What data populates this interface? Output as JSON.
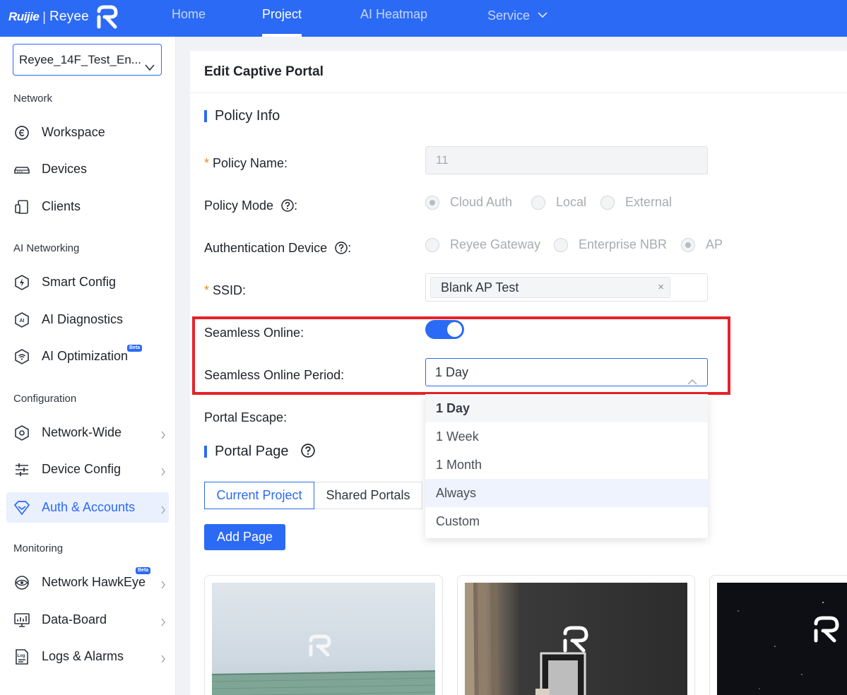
{
  "topbar": {
    "brand": {
      "ruijie": "Ruijie",
      "separator": "|",
      "reyee": "Reyee"
    },
    "nav": [
      {
        "label": "Home",
        "active": false
      },
      {
        "label": "Project",
        "active": true
      },
      {
        "label": "AI Heatmap",
        "active": false
      },
      {
        "label": "Service",
        "active": false,
        "has_dropdown": true
      }
    ],
    "color": "#2b6af5"
  },
  "sidebar": {
    "project_selector": "Reyee_14F_Test_En...",
    "sections": [
      {
        "label": "Network"
      },
      {
        "label": "AI Networking"
      },
      {
        "label": "Configuration"
      },
      {
        "label": "Monitoring"
      }
    ],
    "items": [
      {
        "label": "Workspace",
        "icon": "workspace-icon"
      },
      {
        "label": "Devices",
        "icon": "devices-icon"
      },
      {
        "label": "Clients",
        "icon": "clients-icon"
      },
      {
        "label": "Smart Config",
        "icon": "smart-config-icon"
      },
      {
        "label": "AI Diagnostics",
        "icon": "ai-diagnostics-icon"
      },
      {
        "label": "AI Optimization",
        "icon": "ai-optimization-icon",
        "badge": "Beta"
      },
      {
        "label": "Network-Wide",
        "icon": "network-wide-icon",
        "has_arrow": true
      },
      {
        "label": "Device Config",
        "icon": "device-config-icon",
        "has_arrow": true
      },
      {
        "label": "Auth & Accounts",
        "icon": "auth-accounts-icon",
        "has_arrow": true,
        "active": true
      },
      {
        "label": "Network HawkEye",
        "icon": "hawkeye-icon",
        "has_arrow": true,
        "badge": "Beta"
      },
      {
        "label": "Data-Board",
        "icon": "data-board-icon",
        "has_arrow": true
      },
      {
        "label": "Logs & Alarms",
        "icon": "logs-alarms-icon",
        "has_arrow": true
      }
    ]
  },
  "page": {
    "title": "Edit Captive Portal",
    "policy_info": {
      "section_title": "Policy Info",
      "policy_name": {
        "label": "Policy Name",
        "value": "11",
        "required": true,
        "disabled": true
      },
      "policy_mode": {
        "label": "Policy Mode",
        "options": [
          "Cloud Auth",
          "Local",
          "External"
        ],
        "selected": "Cloud Auth"
      },
      "auth_device": {
        "label": "Authentication Device",
        "options": [
          "Reyee Gateway",
          "Enterprise NBR",
          "AP"
        ],
        "selected": "AP"
      },
      "ssid": {
        "label": "SSID",
        "required": true,
        "tags": [
          "Blank AP Test"
        ],
        "remove_glyph": "×"
      },
      "seamless_online": {
        "label": "Seamless Online",
        "enabled": true
      },
      "seamless_period": {
        "label": "Seamless Online Period",
        "value": "1 Day",
        "options": [
          "1 Day",
          "1 Week",
          "1 Month",
          "Always",
          "Custom"
        ],
        "hovered": "Always"
      },
      "portal_escape": {
        "label": "Portal Escape"
      }
    },
    "portal_page": {
      "section_title": "Portal Page",
      "tabs": [
        "Current Project",
        "Shared Portals"
      ],
      "active_tab": "Current Project",
      "add_button": "Add Page"
    },
    "label_colon": ":"
  },
  "colors": {
    "accent": "#2b6af5",
    "highlight_box": "#e5232a",
    "required_mark": "#f08a24"
  }
}
